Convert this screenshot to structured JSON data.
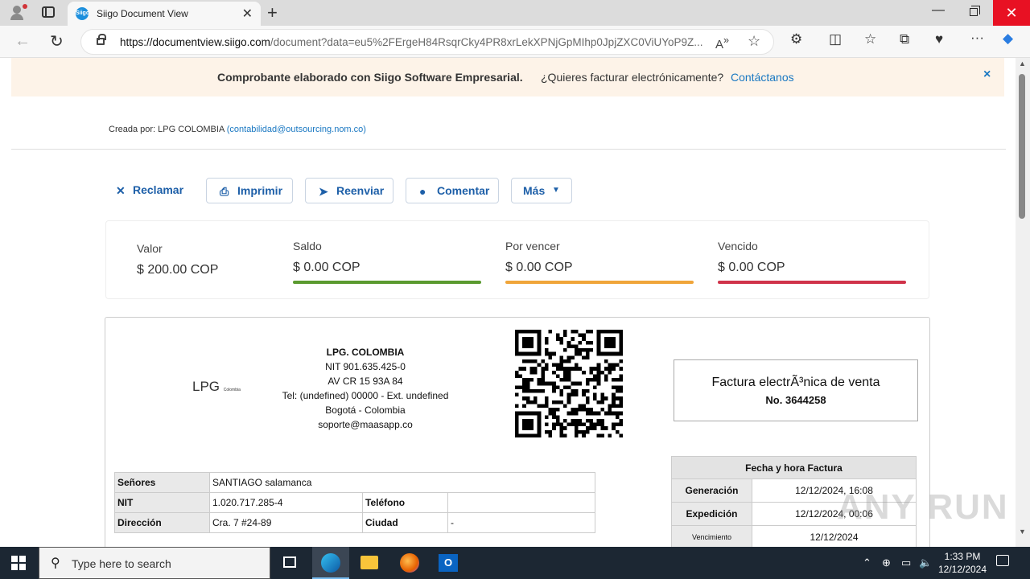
{
  "browser": {
    "tab_title": "Siigo Document View",
    "tab_favicon_text": "Siigo",
    "url_host": "https://documentview.siigo.com",
    "url_rest": "/document?data=eu5%2FErgeH84RsqrCky4PR8xrLekXPNjGpMIhp0JpjZXC0ViUYoP9Z..."
  },
  "banner": {
    "bold_text": "Comprobante elaborado con Siigo Software Empresarial.",
    "question": "¿Quieres facturar electrónicamente?",
    "link": "Contáctanos",
    "close": "×"
  },
  "creator": {
    "prefix": "Creada por: LPG COLOMBIA",
    "email": "(contabilidad@outsourcing.nom.co)"
  },
  "actions": {
    "reclamar": "Reclamar",
    "imprimir": "Imprimir",
    "reenviar": "Reenviar",
    "comentar": "Comentar",
    "mas": "Más"
  },
  "summary": {
    "valor_label": "Valor",
    "valor": "$ 200.00 COP",
    "saldo_label": "Saldo",
    "saldo": "$ 0.00 COP",
    "por_vencer_label": "Por vencer",
    "por_vencer": "$ 0.00 COP",
    "vencido_label": "Vencido",
    "vencido": "$ 0.00 COP",
    "colors": {
      "saldo": "#5a9a2f",
      "por_vencer": "#f0a53a",
      "vencido": "#d0334a"
    }
  },
  "invoice": {
    "logo_text": "LPG",
    "logo_small": "Colombia",
    "company_name": "LPG. COLOMBIA",
    "nit": "NIT 901.635.425-0",
    "address": "AV CR 15 93A 84",
    "phone": "Tel: (undefined) 00000 - Ext. undefined",
    "city": "Bogotá - Colombia",
    "email": "soporte@maasapp.co",
    "doc_type": "Factura electrÃ³nica de venta",
    "doc_number": "No. 3644258",
    "client": {
      "senores_label": "Señores",
      "senores": "SANTIAGO salamanca",
      "nit_label": "NIT",
      "nit": "1.020.717.285-4",
      "telefono_label": "Teléfono",
      "telefono": "",
      "direccion_label": "Dirección",
      "direccion": "Cra. 7 #24-89",
      "ciudad_label": "Ciudad",
      "ciudad": "-"
    },
    "dates": {
      "header": "Fecha y hora Factura",
      "generacion_label": "Generación",
      "generacion": "12/12/2024, 16:08",
      "expedicion_label": "Expedición",
      "expedicion": "12/12/2024, 00:06",
      "vencimiento_label": "Vencimiento",
      "vencimiento": "12/12/2024"
    }
  },
  "watermark": "ANY RUN",
  "taskbar": {
    "search_placeholder": "Type here to search",
    "time": "1:33 PM",
    "date": "12/12/2024"
  }
}
